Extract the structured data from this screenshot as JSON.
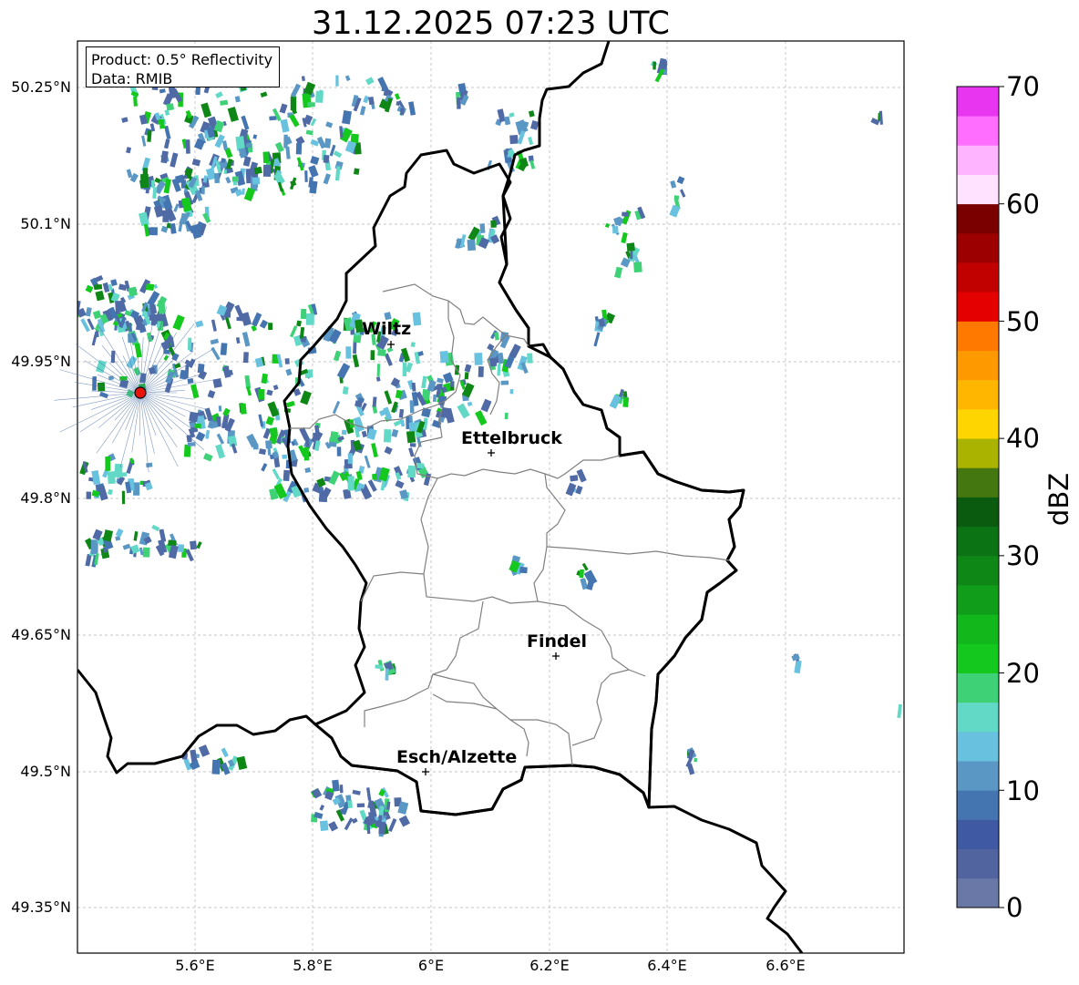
{
  "title": "31.12.2025 07:23 UTC",
  "info_box": {
    "product": "Product: 0.5° Reflectivity",
    "data": "Data: RMIB"
  },
  "axes": {
    "lat_labels": [
      "50.25°N",
      "50.1°N",
      "49.95°N",
      "49.8°N",
      "49.65°N",
      "49.5°N",
      "49.35°N"
    ],
    "lon_labels": [
      "5.6°E",
      "5.8°E",
      "6°E",
      "6.2°E",
      "6.4°E",
      "6.6°E"
    ],
    "gridlines": "dashed"
  },
  "cities": [
    {
      "name": "Wiltz"
    },
    {
      "name": "Ettelbruck"
    },
    {
      "name": "Findel"
    },
    {
      "name": "Esch/Alzette"
    }
  ],
  "radar_site": {
    "color": "#e8140c"
  },
  "colorbar": {
    "label": "dBZ",
    "ticks": [
      "0",
      "10",
      "20",
      "30",
      "40",
      "50",
      "60",
      "70"
    ],
    "colors": [
      "#6a78a8",
      "#5264a0",
      "#3f5aa2",
      "#4575b0",
      "#5a97c4",
      "#68c1de",
      "#62d8c6",
      "#3fd176",
      "#15c81e",
      "#12b71c",
      "#109d19",
      "#0f8717",
      "#0b7313",
      "#0a5b0f",
      "#447710",
      "#a9b300",
      "#ffd500",
      "#ffb600",
      "#ff9900",
      "#ff7800",
      "#e50000",
      "#c10000",
      "#9c0000",
      "#7a0000",
      "#ffe2ff",
      "#ffb4ff",
      "#ff6eff",
      "#e835f0"
    ]
  }
}
